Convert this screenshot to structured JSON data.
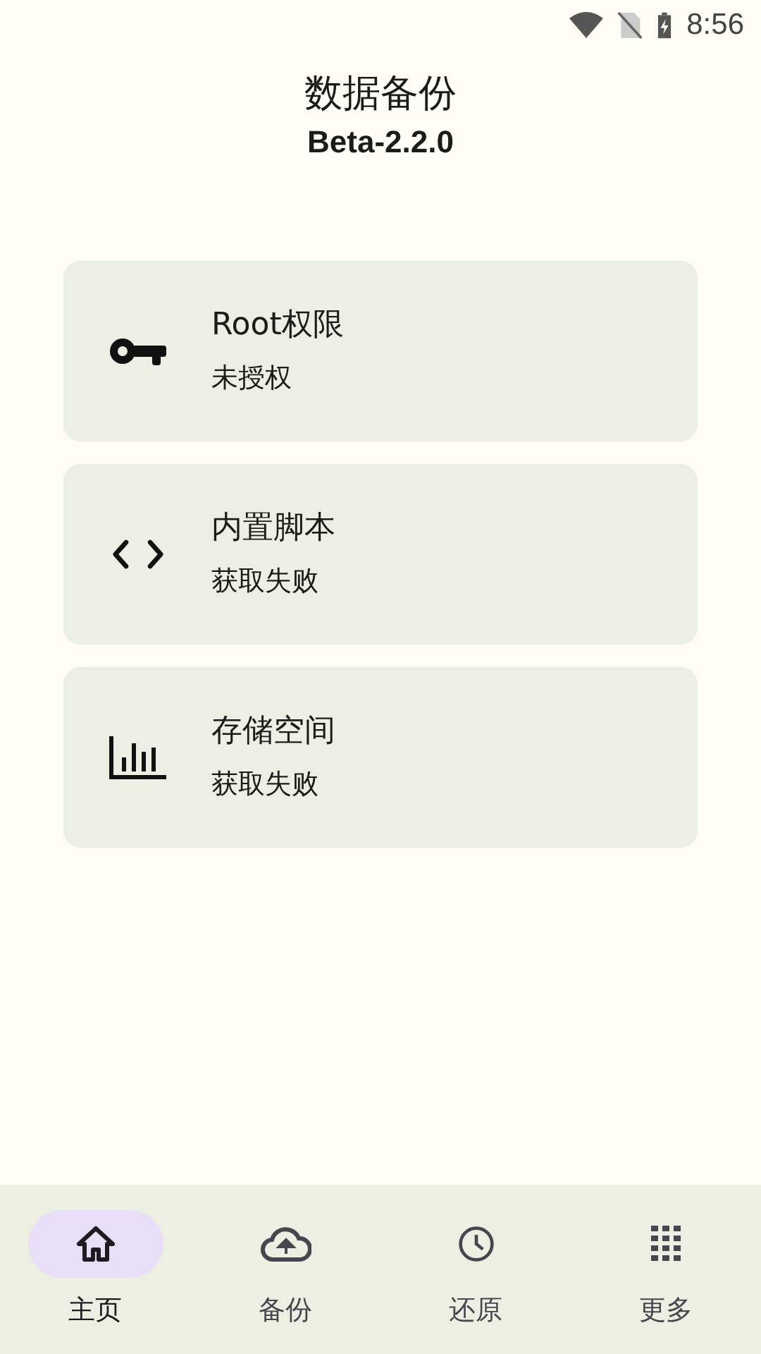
{
  "status_bar": {
    "time": "8:56"
  },
  "header": {
    "title": "数据备份",
    "version": "Beta-2.2.0"
  },
  "cards": [
    {
      "kind": "key",
      "title": "Root权限",
      "status": "未授权"
    },
    {
      "kind": "code",
      "title": "内置脚本",
      "status": "获取失败"
    },
    {
      "kind": "chart",
      "title": "存储空间",
      "status": "获取失败"
    }
  ],
  "bottom_nav": [
    {
      "kind": "home",
      "label": "主页",
      "selected": true
    },
    {
      "kind": "upload",
      "label": "备份",
      "selected": false
    },
    {
      "kind": "history",
      "label": "还原",
      "selected": false
    },
    {
      "kind": "grid",
      "label": "更多",
      "selected": false
    }
  ]
}
